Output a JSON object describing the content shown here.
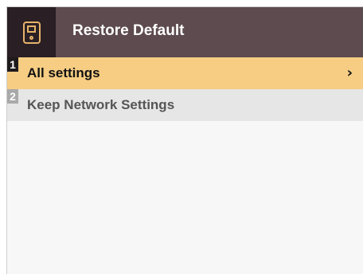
{
  "header": {
    "title": "Restore Default",
    "icon": "device-icon"
  },
  "menu": {
    "items": [
      {
        "index": "1",
        "label": "All settings",
        "selected": true,
        "chevron": "›"
      },
      {
        "index": "2",
        "label": "Keep Network Settings",
        "selected": false
      }
    ]
  },
  "colors": {
    "titlebar": "#5d4b50",
    "icon_box": "#2a1f24",
    "icon_accent": "#e6b36a",
    "selected_row": "#f6cd83",
    "normal_row": "#e6e6e6"
  }
}
